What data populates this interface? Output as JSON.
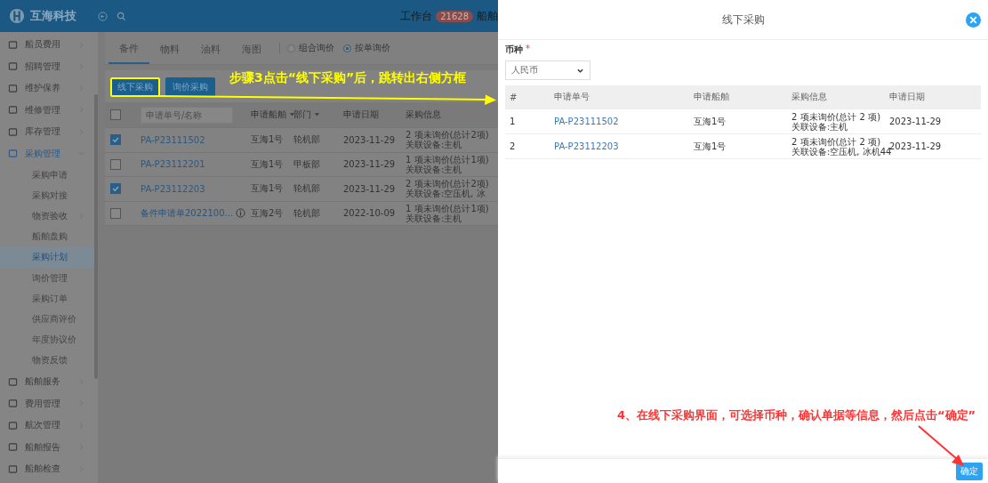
{
  "header": {
    "brand": "互海科技",
    "workbench": "工作台",
    "badge": "21628",
    "cut_label": "船舶"
  },
  "sidebar": [
    {
      "label": "船员费用",
      "expanded": false
    },
    {
      "label": "招聘管理",
      "expanded": false
    },
    {
      "label": "维护保养",
      "expanded": false
    },
    {
      "label": "维修管理",
      "expanded": false
    },
    {
      "label": "库存管理",
      "expanded": false
    },
    {
      "label": "采购管理",
      "expanded": true,
      "children": [
        {
          "label": "采购申请",
          "selected": false,
          "expandable": false
        },
        {
          "label": "采购对接",
          "selected": false,
          "expandable": false
        },
        {
          "label": "物资验收",
          "selected": false,
          "expandable": true
        },
        {
          "label": "船舶盘购",
          "selected": false,
          "expandable": false
        },
        {
          "label": "采购计划",
          "selected": true,
          "expandable": false
        },
        {
          "label": "询价管理",
          "selected": false,
          "expandable": false
        },
        {
          "label": "采购订单",
          "selected": false,
          "expandable": false
        },
        {
          "label": "供应商评价",
          "selected": false,
          "expandable": false
        },
        {
          "label": "年度协议价",
          "selected": false,
          "expandable": false
        },
        {
          "label": "物资反馈",
          "selected": false,
          "expandable": false
        }
      ]
    },
    {
      "label": "船舶服务",
      "expanded": false
    },
    {
      "label": "费用管理",
      "expanded": false
    },
    {
      "label": "航次管理",
      "expanded": false
    },
    {
      "label": "船舶报告",
      "expanded": false
    },
    {
      "label": "船舶检查",
      "expanded": false
    }
  ],
  "tabs": [
    {
      "label": "备件",
      "selected": true
    },
    {
      "label": "物料",
      "selected": false
    },
    {
      "label": "油料",
      "selected": false
    },
    {
      "label": "海图",
      "selected": false
    }
  ],
  "radios": [
    {
      "label": "组合询价",
      "selected": false
    },
    {
      "label": "按单询价",
      "selected": true
    }
  ],
  "actions": [
    {
      "label": "线下采购",
      "highlighted": true
    },
    {
      "label": "询价采购",
      "highlighted": false
    }
  ],
  "table": {
    "select_all_checked": false,
    "search_placeholder": "申请单号/名称",
    "columns": [
      {
        "label": "申请船舶",
        "sortable": true
      },
      {
        "label": "部门",
        "sortable": true
      },
      {
        "label": "申请日期",
        "sortable": false
      },
      {
        "label": "采购信息",
        "sortable": false
      }
    ],
    "rows": [
      {
        "checked": true,
        "request_no": "PA-P23111502",
        "note": false,
        "ship": "互海1号",
        "department": "轮机部",
        "date": "2023-11-29",
        "info_1": "2 项未询价(总计2项)",
        "info_2": "关联设备:主机"
      },
      {
        "checked": false,
        "request_no": "PA-P23112201",
        "note": false,
        "ship": "互海1号",
        "department": "甲板部",
        "date": "2023-11-29",
        "info_1": "1 项未询价(总计1项)",
        "info_2": "关联设备:主机"
      },
      {
        "checked": true,
        "request_no": "PA-P23112203",
        "note": false,
        "ship": "互海1号",
        "department": "轮机部",
        "date": "2023-11-29",
        "info_1": "2 项未询价(总计2项)",
        "info_2": "关联设备:空压机, 冰"
      },
      {
        "checked": false,
        "request_no": "备件申请单2022100...",
        "note": true,
        "ship": "互海2号",
        "department": "轮机部",
        "date": "2022-10-09",
        "info_1": "1 项未询价(总计1项)",
        "info_2": "关联设备:主机"
      }
    ]
  },
  "drawer": {
    "title": "线下采购",
    "currency_label": "币种",
    "required_mark": "*",
    "currency_value": "人民币",
    "columns": [
      "#",
      "申请单号",
      "申请船舶",
      "采购信息",
      "申请日期"
    ],
    "rows": [
      {
        "index": "1",
        "request_no": "PA-P23111502",
        "ship": "互海1号",
        "info_1": "2 项未询价(总计 2 项)",
        "info_2": "关联设备:主机",
        "date": "2023-11-29"
      },
      {
        "index": "2",
        "request_no": "PA-P23112203",
        "ship": "互海1号",
        "info_1": "2 项未询价(总计 2 项)",
        "info_2": "关联设备:空压机, 冰机44",
        "date": "2023-11-29"
      }
    ],
    "confirm": "确定"
  },
  "callouts": [
    {
      "kind": "to_drawer",
      "text": "步骤3点击“线下采购”后，跳转出右侧方框",
      "color": "#ffff00"
    },
    {
      "kind": "to_confirm",
      "text": "4、在线下采购界面，可选择币种，确认单据等信息，然后点击“确定”",
      "color": "#ff3333"
    }
  ]
}
